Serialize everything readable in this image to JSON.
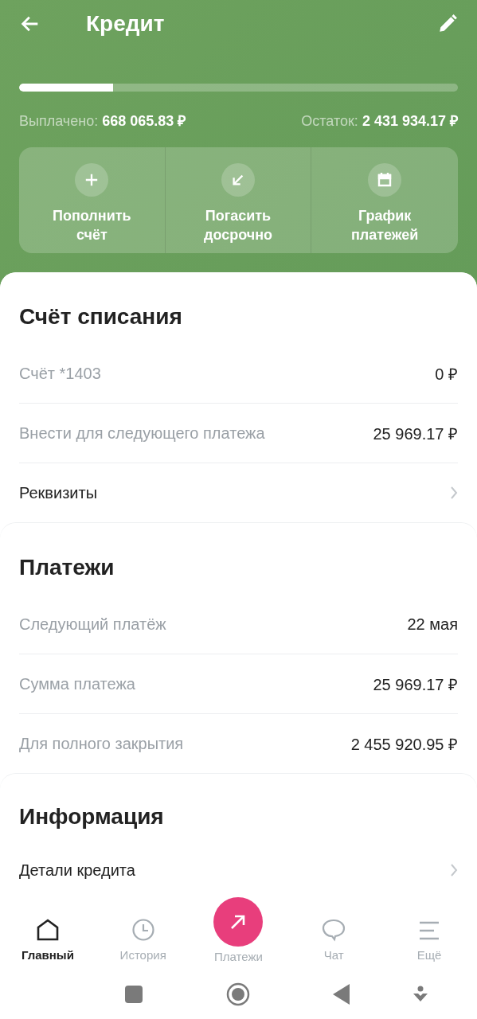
{
  "header": {
    "title": "Кредит"
  },
  "summary": {
    "level": 0.215,
    "paid_label": "Выплачено:",
    "paid": "668 065.83 ₽",
    "rest_label": "Остаток:",
    "rest": "2 431 934.17 ₽"
  },
  "actions": [
    {
      "kind": "plus",
      "lines": [
        "Пополнить",
        "счёт"
      ]
    },
    {
      "kind": "arrow",
      "lines": [
        "Погасить",
        "досрочно"
      ]
    },
    {
      "kind": "calendar",
      "lines": [
        "График",
        "платежей"
      ]
    }
  ],
  "sections": [
    {
      "title": "Счёт списания",
      "rows": [
        {
          "kind": "value",
          "label": "Счёт *1403",
          "value": "0 ₽"
        },
        {
          "kind": "value",
          "label": "Внести для следующего платежа",
          "value": "25 969.17 ₽"
        },
        {
          "kind": "link",
          "label": "Реквизиты"
        }
      ]
    },
    {
      "title": "Платежи",
      "rows": [
        {
          "kind": "value",
          "label": "Следующий платёж",
          "value": "22 мая"
        },
        {
          "kind": "value",
          "label": "Сумма платежа",
          "value": "25 969.17 ₽"
        },
        {
          "kind": "value",
          "label": "Для полного закрытия",
          "value": "2 455 920.95 ₽"
        }
      ]
    },
    {
      "title": "Информация",
      "rows": [
        {
          "kind": "link",
          "label": "Детали кредита"
        }
      ]
    }
  ],
  "nav": [
    {
      "kind": "home",
      "label": "Главный",
      "selected": true
    },
    {
      "kind": "history",
      "label": "История",
      "selected": false
    },
    {
      "kind": "pay",
      "label": "Платежи",
      "selected": false
    },
    {
      "kind": "chat",
      "label": "Чат",
      "selected": false
    },
    {
      "kind": "more",
      "label": "Ещё",
      "selected": false
    }
  ]
}
